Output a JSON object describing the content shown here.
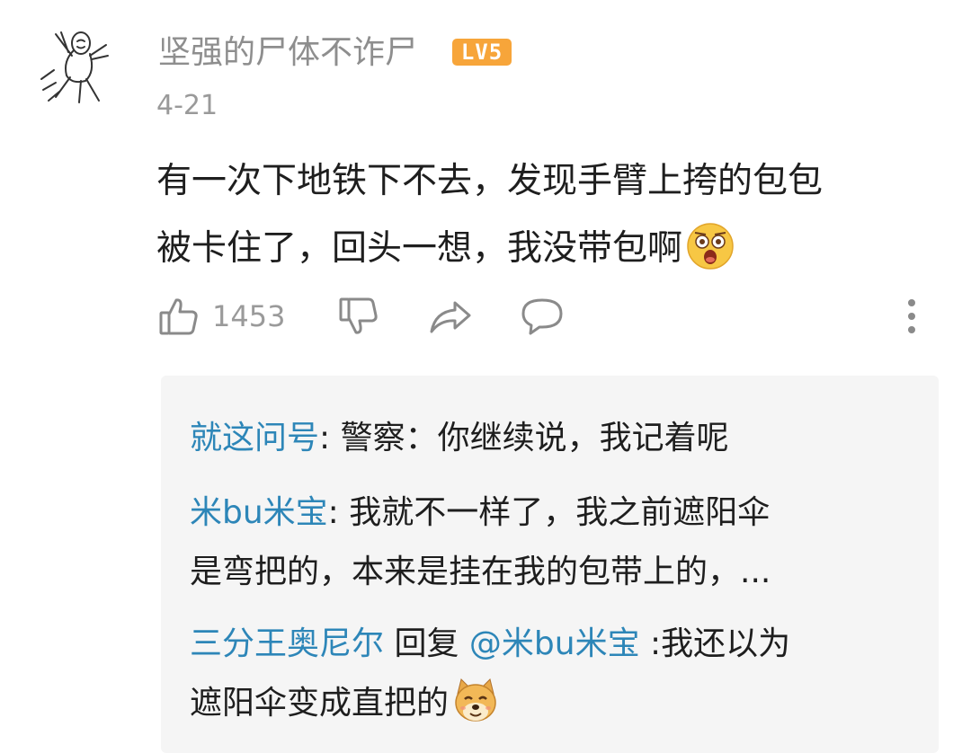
{
  "comment": {
    "username": "坚强的尸体不诈尸",
    "level_badge": "LV5",
    "date": "4-21",
    "text_line1": "有一次下地铁下不去，发现手臂上挎的包包",
    "text_line2": "被卡住了，回头一想，我没带包啊",
    "emoji": "astonished-face-emoji",
    "like_count": "1453",
    "icons": [
      "thumbs-up-icon",
      "thumbs-down-icon",
      "share-icon",
      "comment-bubble-icon",
      "more-vertical-icon"
    ]
  },
  "replies": [
    {
      "name": "就这问号",
      "separator": ": ",
      "text": "警察：你继续说，我记着呢"
    },
    {
      "name": "米bu米宝",
      "separator": ": ",
      "text_line1": "我就不一样了，我之前遮阳伞",
      "text_line2": "是弯把的，本来是挂在我的包带上的，..."
    },
    {
      "name": "三分王奥尼尔",
      "reply_word": " 回复 ",
      "mention": "@米bu米宝",
      "text_line1": " :我还以为",
      "text_line2": "遮阳伞变成直把的",
      "emoji": "doge-emoji"
    }
  ],
  "colors": {
    "username": "#8e8e8e",
    "reply_name": "#2d86b8",
    "badge": "#f7a53a",
    "reply_bg": "#f5f5f5"
  }
}
